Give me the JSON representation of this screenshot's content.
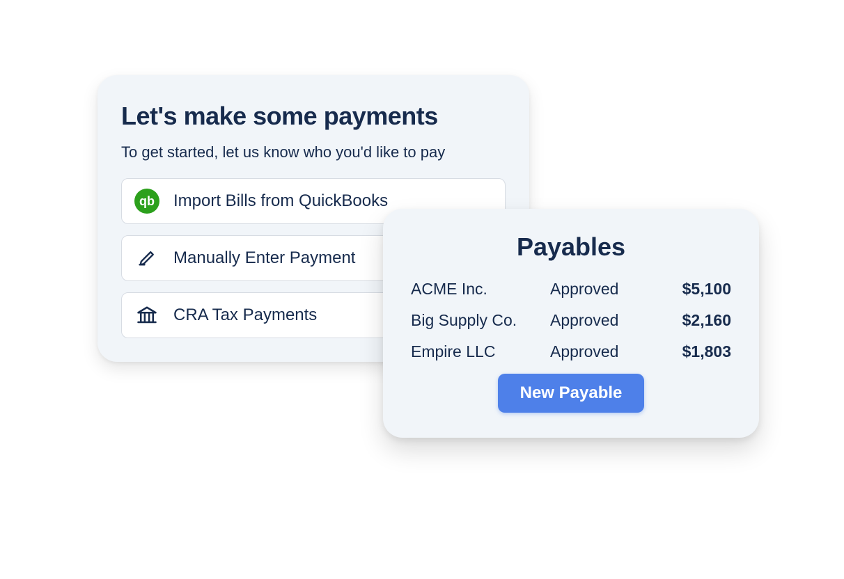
{
  "payments_card": {
    "title": "Let's make some payments",
    "subtitle": "To get started, let us know who you'd like to pay",
    "options": [
      {
        "icon": "quickbooks-icon",
        "label": "Import Bills from QuickBooks"
      },
      {
        "icon": "pencil-icon",
        "label": "Manually Enter Payment"
      },
      {
        "icon": "bank-icon",
        "label": "CRA Tax Payments"
      }
    ]
  },
  "payables_card": {
    "title": "Payables",
    "rows": [
      {
        "name": "ACME Inc.",
        "status": "Approved",
        "amount": "$5,100"
      },
      {
        "name": "Big Supply Co.",
        "status": "Approved",
        "amount": "$2,160"
      },
      {
        "name": "Empire LLC",
        "status": "Approved",
        "amount": "$1,803"
      }
    ],
    "new_button": "New Payable"
  },
  "colors": {
    "card_bg": "#F1F5F9",
    "text": "#172B4D",
    "accent": "#4E80E9",
    "qb_green": "#2CA01C"
  }
}
